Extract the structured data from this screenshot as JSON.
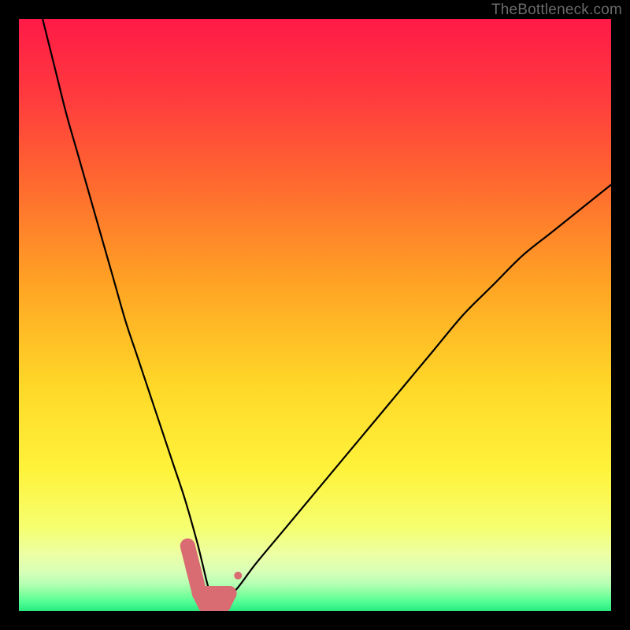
{
  "watermark": "TheBottleneck.com",
  "chart_data": {
    "type": "line",
    "title": "",
    "xlabel": "",
    "ylabel": "",
    "xlim": [
      0,
      100
    ],
    "ylim": [
      0,
      100
    ],
    "grid": false,
    "legend": false,
    "series": [
      {
        "name": "bottleneck-curve",
        "x": [
          4,
          6,
          8,
          10,
          12,
          14,
          16,
          18,
          20,
          22,
          24,
          26,
          28,
          30,
          31,
          32,
          33,
          34,
          35,
          37,
          40,
          45,
          50,
          55,
          60,
          65,
          70,
          75,
          80,
          85,
          90,
          95,
          100
        ],
        "values": [
          100,
          92,
          84,
          77,
          70,
          63,
          56,
          49,
          43,
          37,
          31,
          25,
          19,
          12,
          8,
          4,
          2,
          1,
          2,
          4,
          8,
          14,
          20,
          26,
          32,
          38,
          44,
          50,
          55,
          60,
          64,
          68,
          72
        ]
      }
    ],
    "markers": {
      "name": "highlight-band",
      "color": "#d96b72",
      "x": [
        28.5,
        29.5,
        30.5,
        31.5,
        32.5,
        33.5,
        34.5,
        35.5,
        37.0
      ],
      "values": [
        11,
        7,
        3,
        1,
        1,
        1,
        1,
        3,
        6
      ]
    },
    "gradient_bands": [
      {
        "pos": 0.0,
        "color": "#ff1a47"
      },
      {
        "pos": 0.13,
        "color": "#ff3a3e"
      },
      {
        "pos": 0.28,
        "color": "#ff6a2f"
      },
      {
        "pos": 0.45,
        "color": "#ffa424"
      },
      {
        "pos": 0.62,
        "color": "#ffd828"
      },
      {
        "pos": 0.76,
        "color": "#fff23a"
      },
      {
        "pos": 0.86,
        "color": "#f5ff70"
      },
      {
        "pos": 0.905,
        "color": "#ecffa5"
      },
      {
        "pos": 0.935,
        "color": "#d7ffb8"
      },
      {
        "pos": 0.955,
        "color": "#b3ffb3"
      },
      {
        "pos": 0.972,
        "color": "#7dff9d"
      },
      {
        "pos": 0.986,
        "color": "#4dfd94"
      },
      {
        "pos": 1.0,
        "color": "#28e87e"
      }
    ]
  }
}
